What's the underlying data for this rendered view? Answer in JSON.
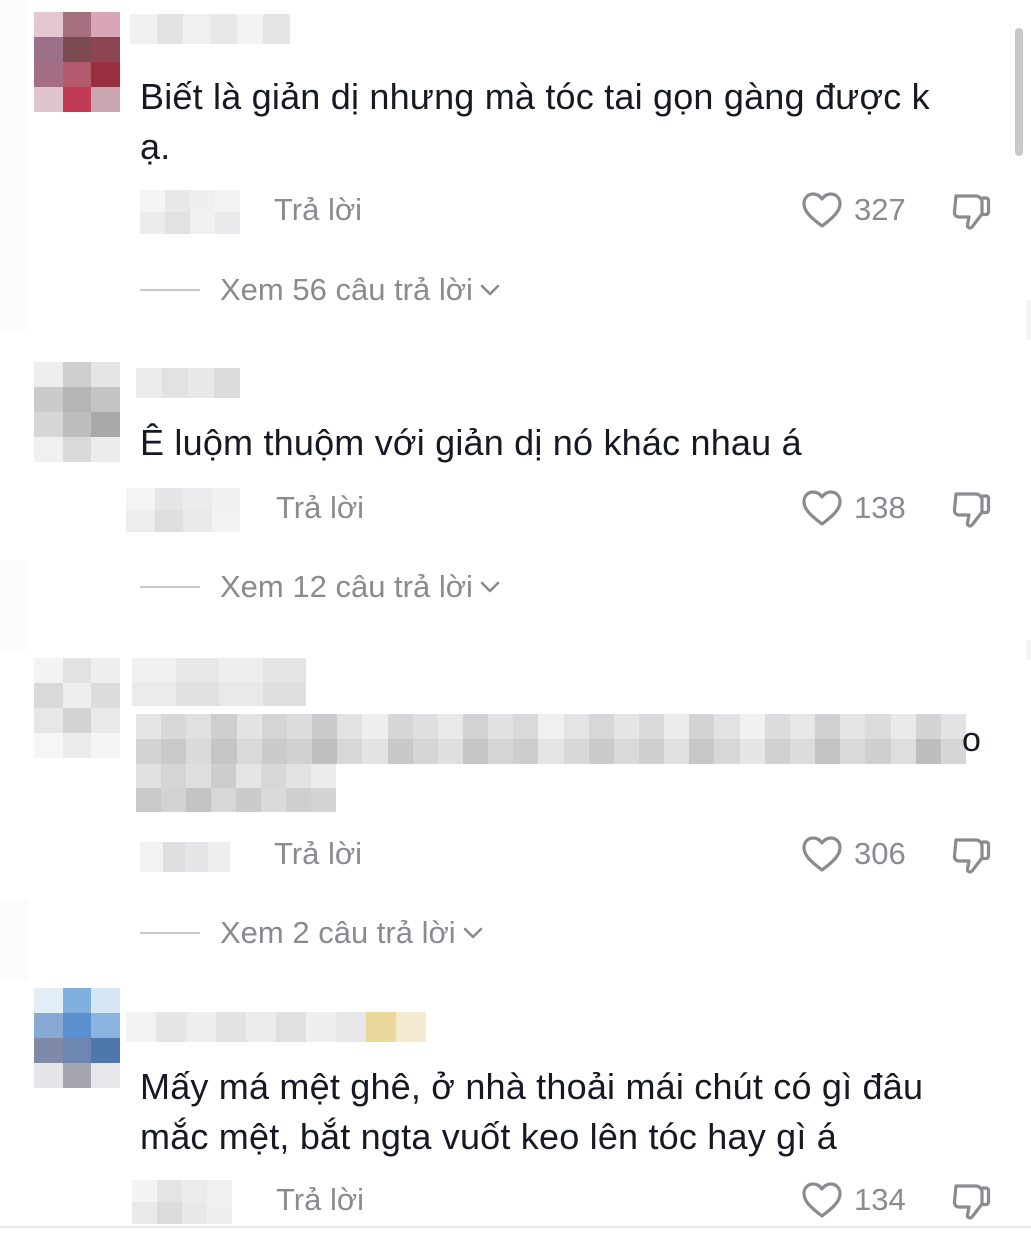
{
  "colors": {
    "text_primary": "#161823",
    "text_secondary": "#8a8b91",
    "icon": "#8a8b91"
  },
  "icons": {
    "like": "heart-outline-icon",
    "dislike": "thumbs-down-outline-icon",
    "expand": "chevron-down-icon"
  },
  "comments": [
    {
      "text_lines": [
        "Biết là giản dị nhưng mà tóc tai gọn gàng được k",
        "ạ."
      ],
      "reply_label": "Trả lời",
      "likes": "327",
      "view_replies": "Xem 56 câu trả lời"
    },
    {
      "text_lines": [
        "Ê luộm thuộm với giản dị nó khác nhau á"
      ],
      "reply_label": "Trả lời",
      "likes": "138",
      "view_replies": "Xem 12 câu trả lời"
    },
    {
      "text_lines": [],
      "text_tail": "o",
      "reply_label": "Trả lời",
      "likes": "306",
      "view_replies": "Xem 2 câu trả lời"
    },
    {
      "text_lines": [
        "Mấy má mệt ghê, ở nhà thoải mái chút có gì đâu",
        "mắc mệt, bắt ngta vuốt keo lên tóc hay gì á"
      ],
      "reply_label": "Trả lời",
      "likes": "134"
    }
  ]
}
